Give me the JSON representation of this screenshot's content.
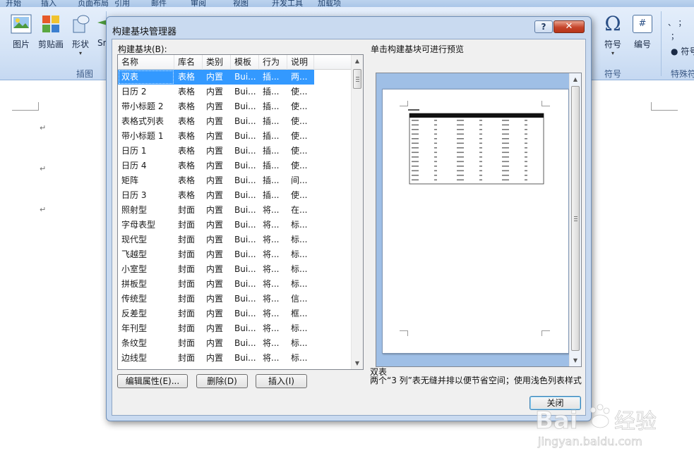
{
  "ribbon": {
    "tabs": [
      "开始",
      "插入",
      "页面布局",
      "引用",
      "邮件",
      "审阅",
      "视图",
      "开发工具",
      "加载项"
    ],
    "buttons": [
      {
        "label": "图片",
        "icon": "picture-icon"
      },
      {
        "label": "剪贴画",
        "icon": "clipart-icon"
      },
      {
        "label": "形状",
        "icon": "shapes-icon"
      },
      {
        "label": "Sm",
        "icon": "smartart-icon"
      },
      {
        "label": "符号",
        "icon": "omega-icon",
        "glyph": "Ω"
      },
      {
        "label": "编号",
        "icon": "number-icon",
        "glyph": "#"
      }
    ],
    "groups": {
      "illustrations": "插图",
      "symbols": "符号",
      "special": "特殊符"
    },
    "special_symbols": "；",
    "special_symbol_label": "符号",
    "special_top": "、  ；",
    "symbols_button_suffix": "▾"
  },
  "dialog": {
    "title": "构建基块管理器",
    "help_label": "?",
    "close_label": "✕",
    "list_label": "构建基块(B):",
    "preview_label": "单击构建基块可进行预览",
    "columns": [
      "名称",
      "库名",
      "类别",
      "模板",
      "行为",
      "说明"
    ],
    "rows": [
      [
        "双表",
        "表格",
        "内置",
        "Bui...",
        "插...",
        "两..."
      ],
      [
        "日历 2",
        "表格",
        "内置",
        "Bui...",
        "插...",
        "使..."
      ],
      [
        "带小标题 2",
        "表格",
        "内置",
        "Bui...",
        "插...",
        "使..."
      ],
      [
        "表格式列表",
        "表格",
        "内置",
        "Bui...",
        "插...",
        "使..."
      ],
      [
        "带小标题 1",
        "表格",
        "内置",
        "Bui...",
        "插...",
        "使..."
      ],
      [
        "日历 1",
        "表格",
        "内置",
        "Bui...",
        "插...",
        "使..."
      ],
      [
        "日历 4",
        "表格",
        "内置",
        "Bui...",
        "插...",
        "使..."
      ],
      [
        "矩阵",
        "表格",
        "内置",
        "Bui...",
        "插...",
        "间..."
      ],
      [
        "日历 3",
        "表格",
        "内置",
        "Bui...",
        "插...",
        "使..."
      ],
      [
        "照射型",
        "封面",
        "内置",
        "Bui...",
        "将...",
        "在..."
      ],
      [
        "字母表型",
        "封面",
        "内置",
        "Bui...",
        "将...",
        "标..."
      ],
      [
        "现代型",
        "封面",
        "内置",
        "Bui...",
        "将...",
        "标..."
      ],
      [
        "飞越型",
        "封面",
        "内置",
        "Bui...",
        "将...",
        "标..."
      ],
      [
        "小室型",
        "封面",
        "内置",
        "Bui...",
        "将...",
        "标..."
      ],
      [
        "拼板型",
        "封面",
        "内置",
        "Bui...",
        "将...",
        "标..."
      ],
      [
        "传统型",
        "封面",
        "内置",
        "Bui...",
        "将...",
        "信..."
      ],
      [
        "反差型",
        "封面",
        "内置",
        "Bui...",
        "将...",
        "框..."
      ],
      [
        "年刊型",
        "封面",
        "内置",
        "Bui...",
        "将...",
        "标..."
      ],
      [
        "条纹型",
        "封面",
        "内置",
        "Bui...",
        "将...",
        "标..."
      ],
      [
        "边线型",
        "封面",
        "内置",
        "Bui...",
        "将...",
        "标..."
      ]
    ],
    "selected_index": 0,
    "buttons": {
      "edit": "编辑属性(E)...",
      "delete": "删除(D)",
      "insert": "插入(I)",
      "close": "关闭"
    },
    "preview": {
      "name": "双表",
      "description": "两个“3 列”表无缝并排以便节省空间；使用浅色列表样式"
    }
  },
  "watermark": {
    "text": "Baidu 经验",
    "url_text": "jingyan.baidu.com"
  },
  "colors": {
    "selection": "#3399ff",
    "dialog_frame": "#c9daf0",
    "preview_bg": "#9fbfe6"
  }
}
